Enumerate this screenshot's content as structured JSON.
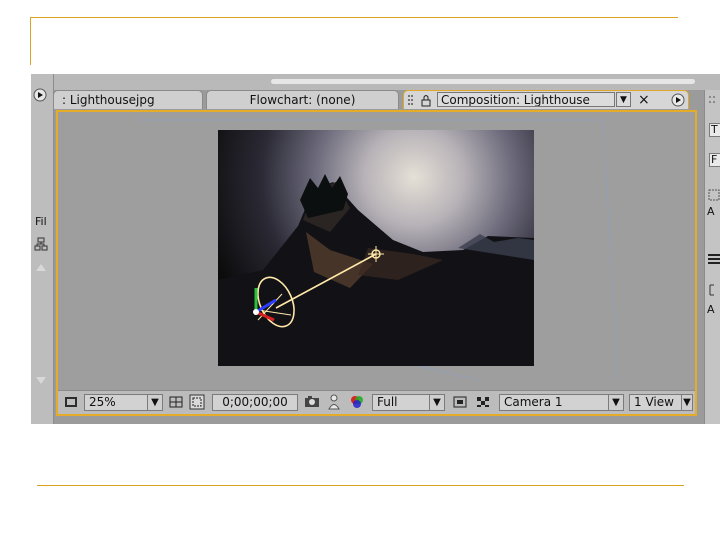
{
  "slide": {
    "accent_color": "#d9a520"
  },
  "tabs": {
    "footage": ": Lighthousejpg",
    "flowchart": "Flowchart: (none)",
    "composition": "Composition: Lighthouse",
    "dropdown_glyph": "▼",
    "close_glyph": "×"
  },
  "left_panel": {
    "file_label": "Fil"
  },
  "status_bar": {
    "zoom": "25%",
    "timecode": "0;00;00;00",
    "resolution": "Full",
    "active_camera": "Camera 1",
    "view_layout": "1 View",
    "dropdown_glyph": "▼"
  },
  "right_panel": {
    "letter_t": "T",
    "letter_f": "F",
    "letter_a1": "A",
    "letter_a2": "A"
  },
  "colors": {
    "panel_border": "#e5ac2a",
    "ui_gray": "#9b9b9b"
  }
}
